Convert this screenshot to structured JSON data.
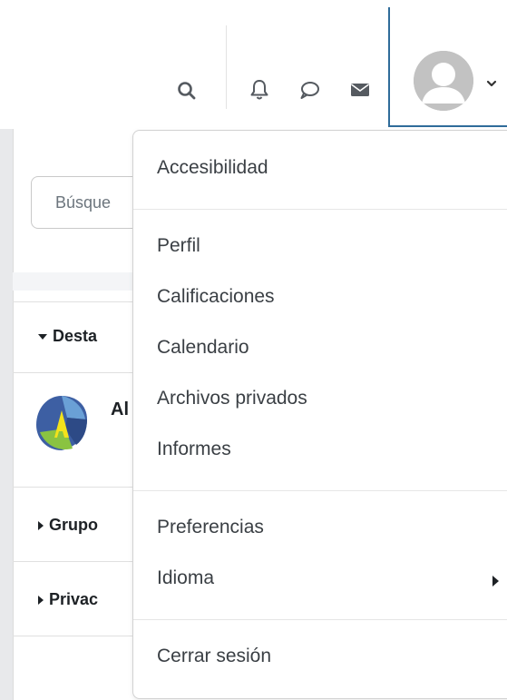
{
  "navbar": {
    "icons": [
      "search-icon",
      "bell-icon",
      "chat-bubble-icon",
      "envelope-icon"
    ],
    "user_avatar": "avatar",
    "accent_color": "#2f6c9a"
  },
  "drawer": {
    "search_placeholder": "Búsque",
    "sections": [
      {
        "label": "Desta",
        "expanded": true
      },
      {
        "label": "Grupo",
        "expanded": false
      },
      {
        "label": "Privac",
        "expanded": false
      }
    ],
    "course_initials": "Al"
  },
  "user_menu": {
    "accessibility": "Accesibilidad",
    "profile": "Perfil",
    "grades": "Calificaciones",
    "calendar": "Calendario",
    "private_files": "Archivos privados",
    "reports": "Informes",
    "preferences": "Preferencias",
    "language": "Idioma",
    "logout": "Cerrar sesión"
  }
}
